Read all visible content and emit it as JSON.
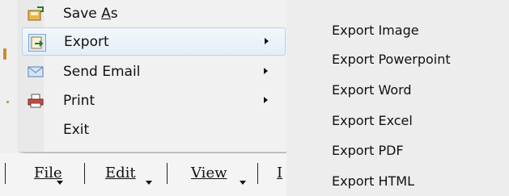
{
  "file_menu": {
    "items": [
      {
        "label": "Save As",
        "icon": "save-icon",
        "has_submenu": false
      },
      {
        "label": "Export",
        "icon": "export-icon",
        "has_submenu": true,
        "highlighted": true
      },
      {
        "label": "Send Email",
        "icon": "envelope-icon",
        "has_submenu": true
      },
      {
        "label": "Print",
        "icon": "printer-icon",
        "has_submenu": true
      },
      {
        "label": "Exit",
        "icon": "",
        "has_submenu": false
      }
    ]
  },
  "export_submenu": {
    "items": [
      {
        "label": "Export Image"
      },
      {
        "label": "Export Powerpoint"
      },
      {
        "label": "Export Word"
      },
      {
        "label": "Export Excel"
      },
      {
        "label": "Export PDF"
      },
      {
        "label": "Export HTML"
      }
    ]
  },
  "menu_bar": {
    "items": [
      {
        "label": "File"
      },
      {
        "label": "Edit"
      },
      {
        "label": "View"
      },
      {
        "label": "I"
      }
    ]
  },
  "colors": {
    "highlight_border": "#b9d1ea",
    "highlight_fill": "#e4eef8",
    "menu_bg": "#f1f1f1",
    "submenu_bg": "#ededed"
  }
}
